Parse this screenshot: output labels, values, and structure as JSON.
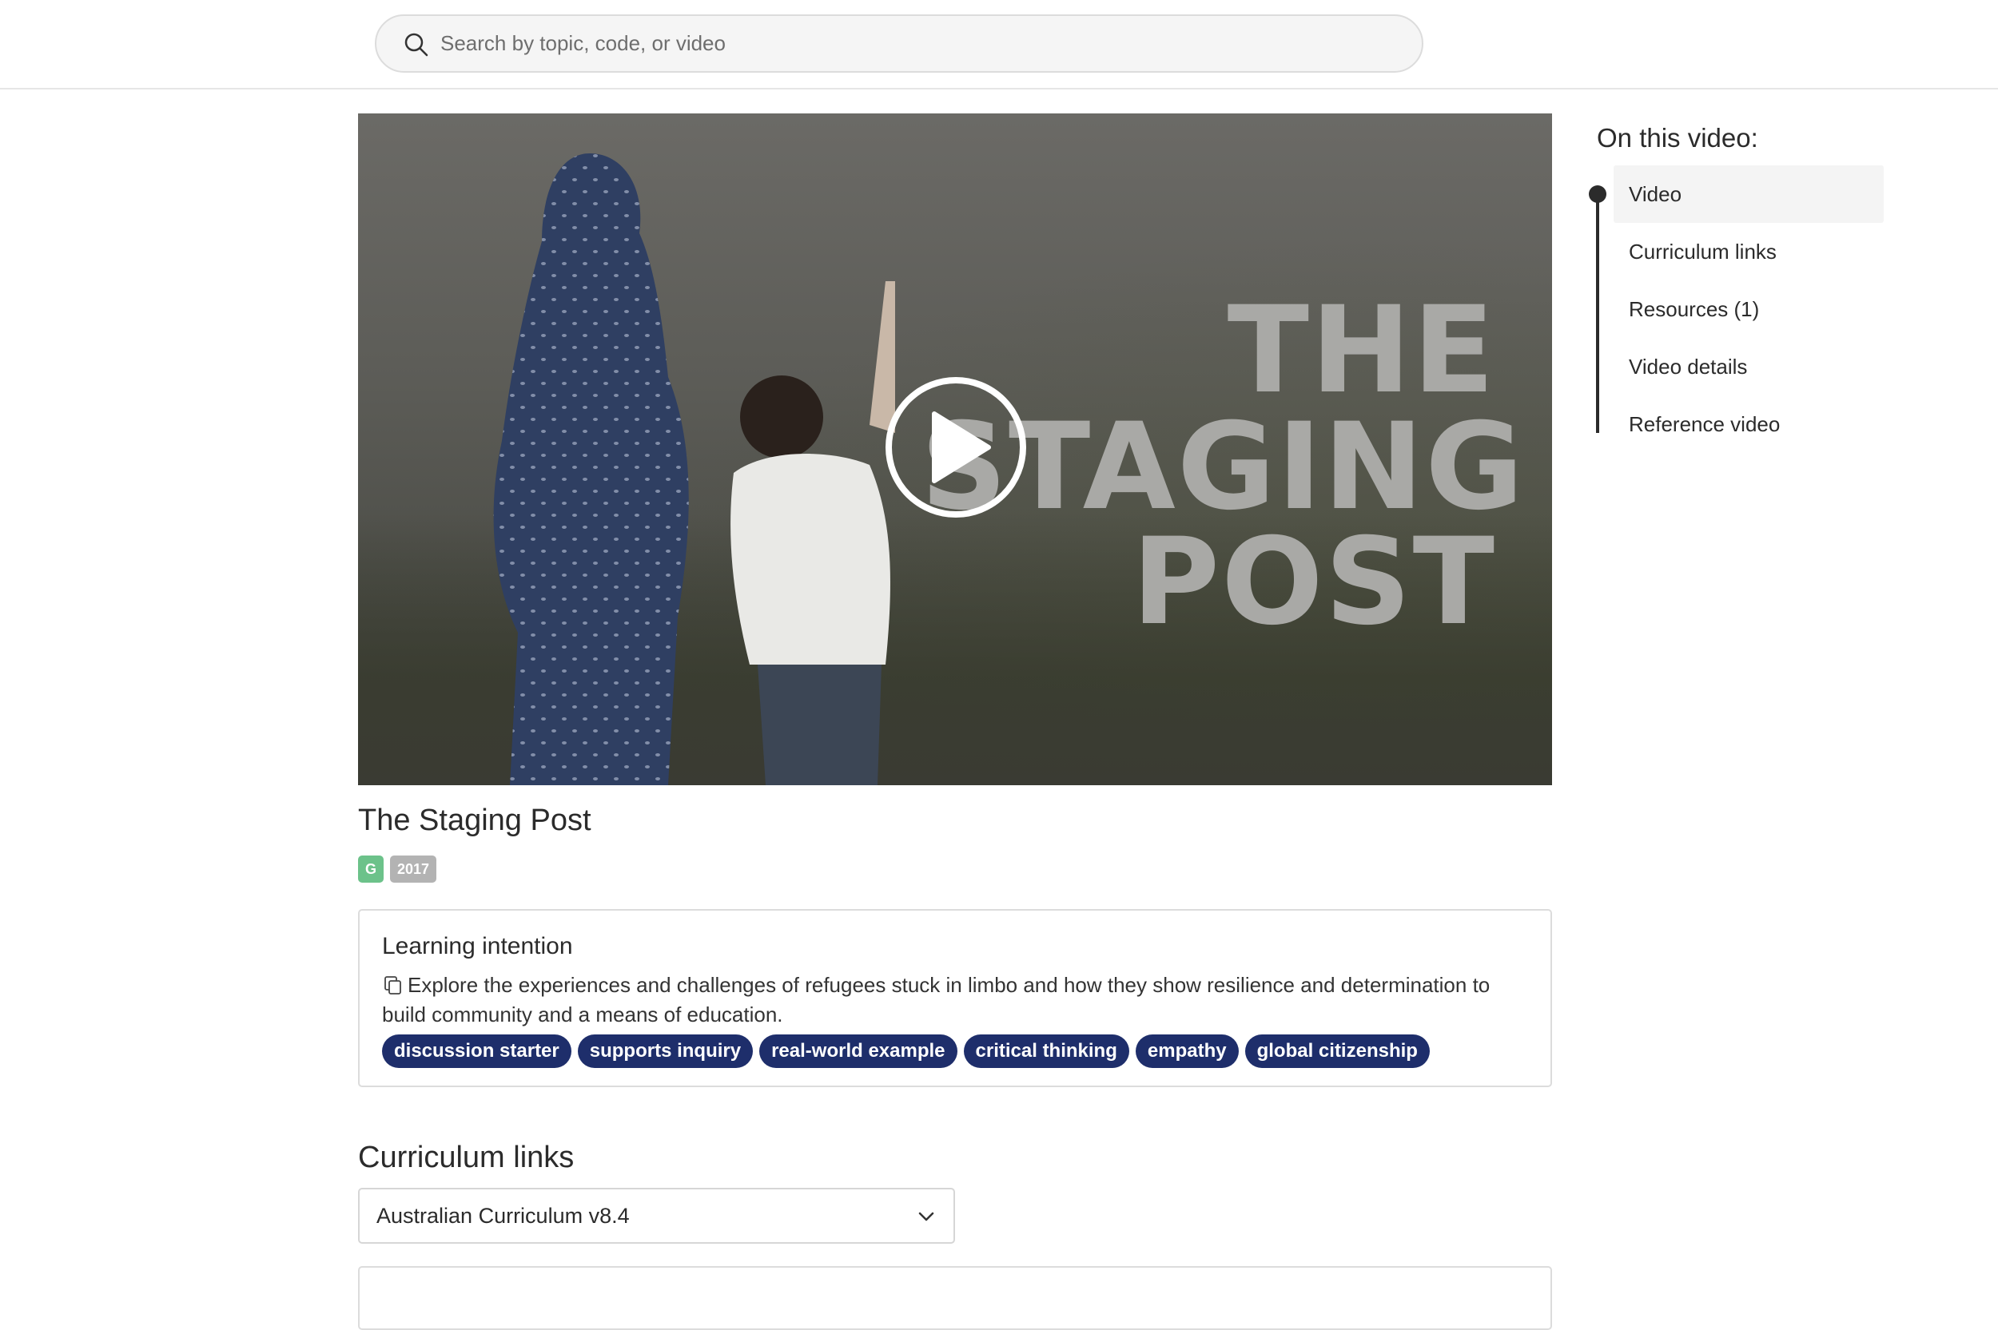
{
  "search": {
    "placeholder": "Search by topic, code, or video"
  },
  "video": {
    "poster_title_lines": [
      "THE",
      "STAGING",
      "POST"
    ],
    "play_label": "Play video"
  },
  "title": "The Staging Post",
  "badges": {
    "rating": "G",
    "year": "2017"
  },
  "learning_intention": {
    "heading": "Learning intention",
    "text": "Explore the experiences and challenges of refugees stuck in limbo and how they show resilience and determination to build community and a means of education.",
    "tags": [
      "discussion starter",
      "supports inquiry",
      "real-world example",
      "critical thinking",
      "empathy",
      "global citizenship"
    ]
  },
  "curriculum_links": {
    "heading": "Curriculum links",
    "selected": "Australian Curriculum v8.4"
  },
  "toc": {
    "title": "On this video:",
    "items": [
      {
        "label": "Video",
        "active": true
      },
      {
        "label": "Curriculum links",
        "active": false
      },
      {
        "label": "Resources (1)",
        "active": false
      },
      {
        "label": "Video details",
        "active": false
      },
      {
        "label": "Reference video",
        "active": false
      }
    ]
  },
  "colors": {
    "tag_bg": "#1e2e6b",
    "rating_badge": "#6cc28a",
    "year_badge": "#b3b3b3",
    "toc_active_bg": "#f4f4f4"
  },
  "icons": [
    "search-icon",
    "play-icon",
    "copy-icon",
    "chevron-down-icon"
  ]
}
